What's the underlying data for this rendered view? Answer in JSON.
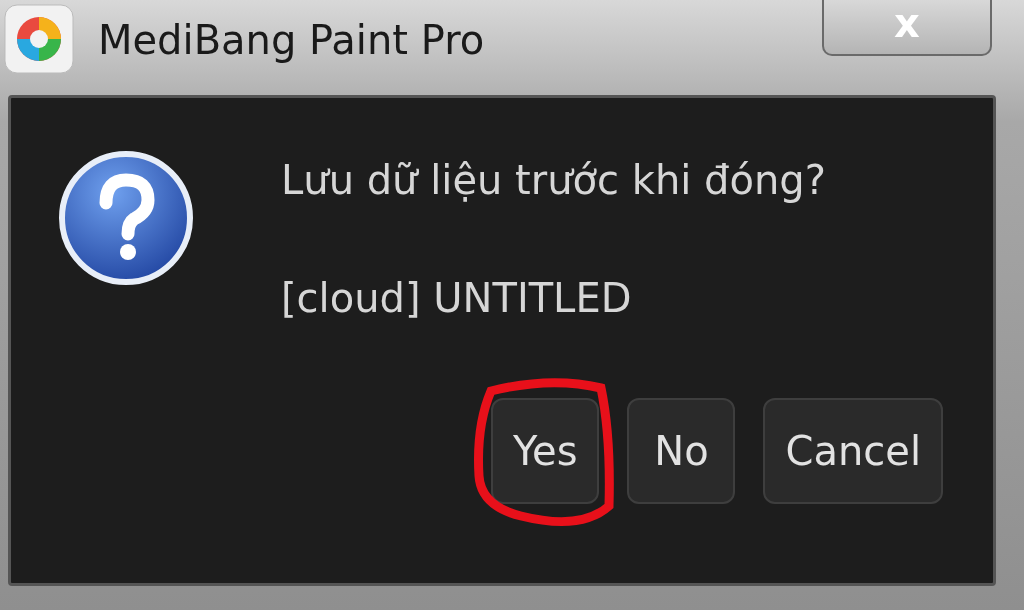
{
  "window": {
    "title": "MediBang Paint Pro",
    "close_label": "x"
  },
  "dialog": {
    "message": "Lưu dữ liệu trước khi đóng?",
    "detail": "[cloud] UNTITLED",
    "kind": "question",
    "buttons": [
      {
        "label": "Yes",
        "highlighted": true
      },
      {
        "label": "No",
        "highlighted": false
      },
      {
        "label": "Cancel",
        "highlighted": false
      }
    ]
  }
}
